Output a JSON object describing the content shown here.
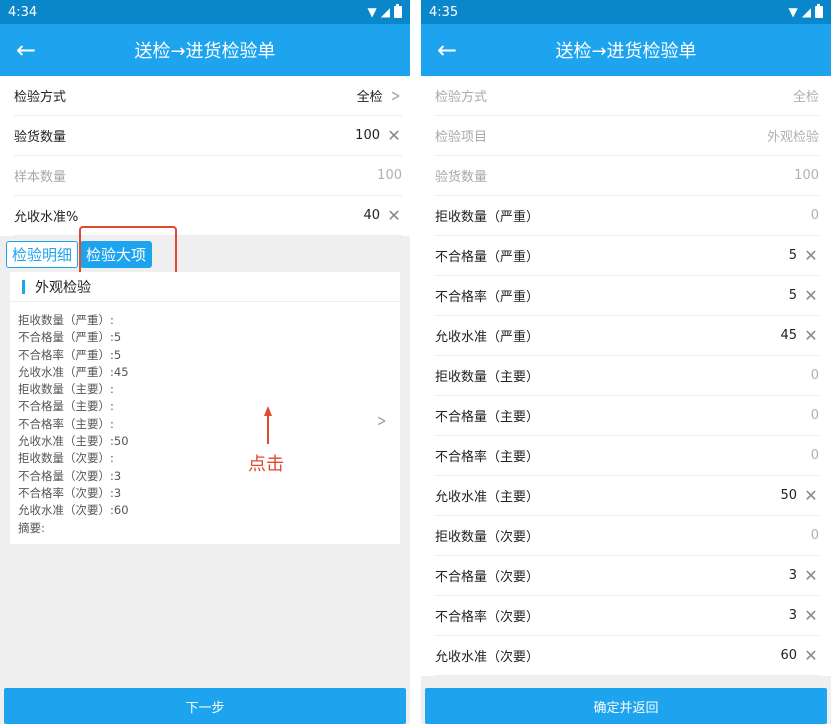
{
  "left": {
    "status": {
      "time": "4:34"
    },
    "title": "送检→进货检验单",
    "fields": [
      {
        "label": "检验方式",
        "value": "全检",
        "suffix": "chevron",
        "disabled": false
      },
      {
        "label": "验货数量",
        "value": "100",
        "suffix": "clear",
        "disabled": false
      },
      {
        "label": "样本数量",
        "value": "100",
        "suffix": "",
        "disabled": true
      },
      {
        "label": "允收水准%",
        "value": "40",
        "suffix": "clear",
        "disabled": false
      }
    ],
    "tabs": [
      {
        "label": "检验明细",
        "active": false
      },
      {
        "label": "检验大项",
        "active": true
      }
    ],
    "card": {
      "title": "外观检验",
      "lines": [
        "拒收数量（严重）:",
        "不合格量（严重）:5",
        "不合格率（严重）:5",
        "允收水准（严重）:45",
        "拒收数量（主要）:",
        "不合格量（主要）:",
        "不合格率（主要）:",
        "允收水准（主要）:50",
        "拒收数量（次要）:",
        "不合格量（次要）:3",
        "不合格率（次要）:3",
        "允收水准（次要）:60",
        "摘要:"
      ]
    },
    "annotation": "点击",
    "button": "下一步"
  },
  "right": {
    "status": {
      "time": "4:35"
    },
    "title": "送检→进货检验单",
    "fields": [
      {
        "label": "检验方式",
        "value": "全检",
        "suffix": "",
        "disabled": true
      },
      {
        "label": "检验项目",
        "value": "外观检验",
        "suffix": "",
        "disabled": true
      },
      {
        "label": "验货数量",
        "value": "100",
        "suffix": "",
        "disabled": true
      },
      {
        "label": "拒收数量（严重）",
        "value": "0",
        "suffix": "",
        "disabled": false,
        "muted": true
      },
      {
        "label": "不合格量（严重）",
        "value": "5",
        "suffix": "clear",
        "disabled": false
      },
      {
        "label": "不合格率（严重）",
        "value": "5",
        "suffix": "clear",
        "disabled": false
      },
      {
        "label": "允收水准（严重）",
        "value": "45",
        "suffix": "clear",
        "disabled": false
      },
      {
        "label": "拒收数量（主要）",
        "value": "0",
        "suffix": "",
        "disabled": false,
        "muted": true
      },
      {
        "label": "不合格量（主要）",
        "value": "0",
        "suffix": "",
        "disabled": false,
        "muted": true
      },
      {
        "label": "不合格率（主要）",
        "value": "0",
        "suffix": "",
        "disabled": false,
        "muted": true
      },
      {
        "label": "允收水准（主要）",
        "value": "50",
        "suffix": "clear",
        "disabled": false
      },
      {
        "label": "拒收数量（次要）",
        "value": "0",
        "suffix": "",
        "disabled": false,
        "muted": true
      },
      {
        "label": "不合格量（次要）",
        "value": "3",
        "suffix": "clear",
        "disabled": false
      },
      {
        "label": "不合格率（次要）",
        "value": "3",
        "suffix": "clear",
        "disabled": false
      },
      {
        "label": "允收水准（次要）",
        "value": "60",
        "suffix": "clear",
        "disabled": false
      }
    ],
    "button": "确定并返回"
  },
  "icons": {
    "back": "back-arrow-icon",
    "clear": "clear-x-icon",
    "chevron": "chevron-right-icon",
    "wifi": "wifi-icon",
    "signal": "signal-icon",
    "battery": "battery-icon"
  },
  "colors": {
    "primary": "#1ea4ee",
    "statusbar": "#0a87ca",
    "annotation": "#e04a2f"
  }
}
